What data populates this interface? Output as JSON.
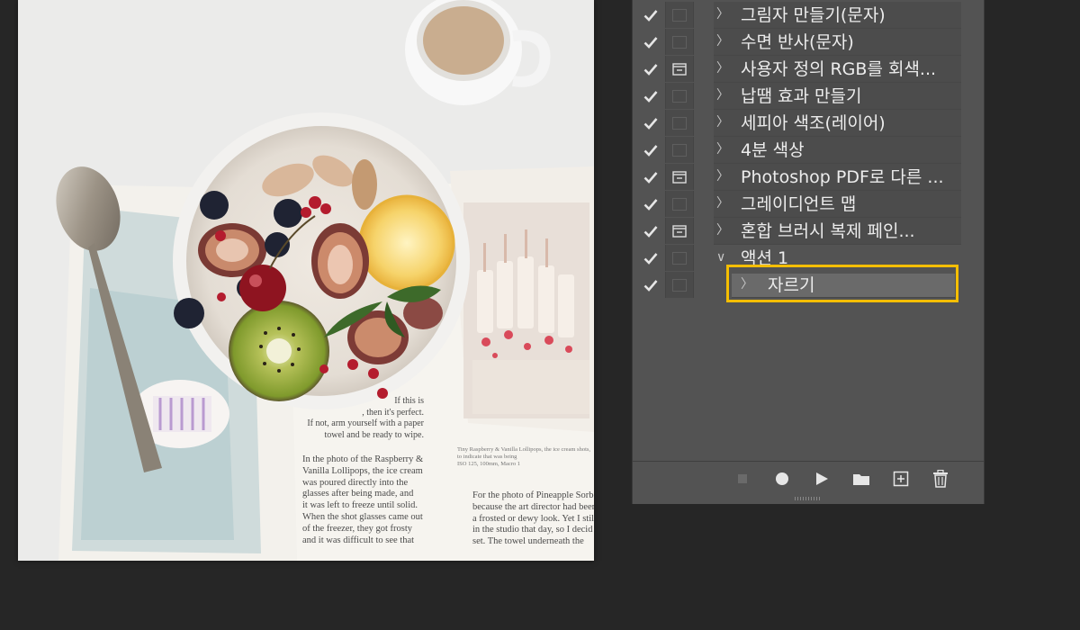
{
  "canvas": {
    "magazine_text_left": "In the photo of the Raspberry &\nVanilla Lollipops, the ice cream\nwas poured directly into the\nglasses after being made, and\nit was left to freeze until solid.\nWhen the shot glasses came out\nof the freezer, they got frosty\nand it was difficult to see that",
    "magazine_text_right": "For the photo of Pineapple Sorbe\nbecause the art director had been\na frosted or dewy look. Yet I still\nin the studio that day, so I decid\nset. The towel underneath the",
    "magazine_text_upper": "If this is\n, then it's perfect.\nIf not, arm yourself with a paper\ntowel and be ready to wipe.",
    "magazine_caption": "Tiny Raspberry & Vanilla Lollipops, the ice cream shots, to indicate that was being\nISO 125, 100mm, Macro 1"
  },
  "actions_panel": {
    "rows": [
      {
        "label": "그림자 만들기(문자)",
        "checked": true,
        "dialog": false
      },
      {
        "label": "수면 반사(문자)",
        "checked": true,
        "dialog": false
      },
      {
        "label": "사용자 정의 RGB를 회색...",
        "checked": true,
        "dialog": true
      },
      {
        "label": "납땜 효과 만들기",
        "checked": true,
        "dialog": false
      },
      {
        "label": "세피아 색조(레이어)",
        "checked": true,
        "dialog": false
      },
      {
        "label": "4분 색상",
        "checked": true,
        "dialog": false
      },
      {
        "label": "Photoshop  PDF로 다른 ...",
        "checked": true,
        "dialog": true
      },
      {
        "label": "그레이디언트 맵",
        "checked": true,
        "dialog": false
      },
      {
        "label": "혼합 브러시 복제 페인...",
        "checked": true,
        "dialog": true
      }
    ],
    "action_set": {
      "label": "액션 1",
      "checked": true,
      "expanded": true
    },
    "selected_step": {
      "label": "자르기",
      "checked": true
    },
    "chevron_collapsed": "〉",
    "chevron_expanded": "∨",
    "highlight_color": "#f5be00"
  },
  "toolbar": {
    "buttons": [
      "stop-icon",
      "record-icon",
      "play-icon",
      "folder-icon",
      "new-action-icon",
      "trash-icon"
    ]
  }
}
